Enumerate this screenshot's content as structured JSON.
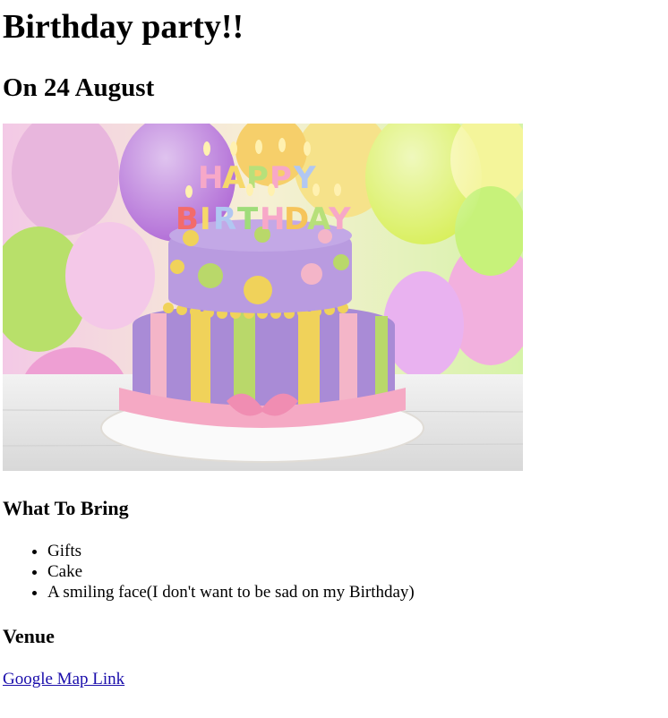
{
  "header": {
    "title": "Birthday party!!",
    "date": "On 24 August"
  },
  "image": {
    "alt": "Birthday cake",
    "candle_text": [
      "HAPPY",
      "BIRTHDAY"
    ]
  },
  "bring": {
    "heading": "What To Bring",
    "items": [
      "Gifts",
      "Cake",
      "A smiling face(I don't want to be sad on my Birthday)"
    ]
  },
  "venue": {
    "heading": "Venue",
    "link_text": "Google Map Link"
  },
  "colors": {
    "link": "#1a0dab",
    "cake_purple": "#a98bd6",
    "cake_pink": "#f4b5c8",
    "cake_yellow": "#f0d25a"
  }
}
